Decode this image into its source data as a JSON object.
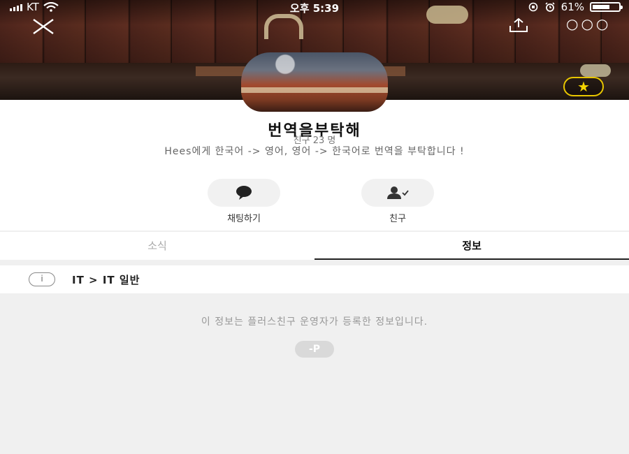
{
  "status_bar": {
    "carrier": "KT",
    "time": "오후 5:39",
    "battery": "61%"
  },
  "header": {
    "close_icon": "close-icon",
    "share_icon": "share-icon",
    "more_icon": "more-icon",
    "more_glyph": "○○○",
    "favorite_icon": "star-icon"
  },
  "profile": {
    "name": "번역을부탁해",
    "friends_count": "친구 23 명",
    "description": "Hees에게 한국어 -> 영어, 영어 -> 한국어로 번역을 부탁합니다 !"
  },
  "actions": {
    "chat_label": "채팅하기",
    "friend_label": "친구"
  },
  "tabs": [
    {
      "label": "소식",
      "active": false
    },
    {
      "label": "정보",
      "active": true
    }
  ],
  "info": {
    "category": "IT > IT 일반",
    "info_icon_glyph": "i",
    "notice": "이 정보는 플러스친구 운영자가 등록한 정보입니다.",
    "logo_text": "-P"
  },
  "colors": {
    "accent_star": "#f5d400",
    "active_tab_underline": "#222222",
    "background": "#f0f0f0"
  }
}
